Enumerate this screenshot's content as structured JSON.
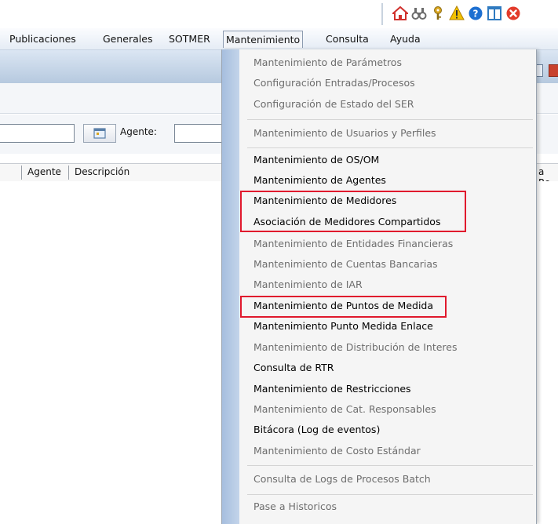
{
  "toolbar": {
    "icons": [
      {
        "name": "home-icon",
        "color": "#d0312d"
      },
      {
        "name": "binoculars-icon",
        "color": "#6b6b6b"
      },
      {
        "name": "key-icon",
        "color": "#d9a520"
      },
      {
        "name": "warning-icon",
        "color": "#f2c200"
      },
      {
        "name": "help-icon",
        "color": "#1c6fd1"
      },
      {
        "name": "columns-icon",
        "color": "#2f7ac0"
      },
      {
        "name": "close-icon",
        "color": "#e23a2a"
      }
    ]
  },
  "menubar": {
    "items": [
      {
        "label": "Publicaciones"
      },
      {
        "label": "Generales"
      },
      {
        "label": "SOTMER"
      },
      {
        "label": "Mantenimiento"
      },
      {
        "label": "Consulta"
      },
      {
        "label": "Ayuda"
      }
    ]
  },
  "filters": {
    "agente_label": "Agente:"
  },
  "grid": {
    "columns": [
      "Agente",
      "Descripción",
      "a Re"
    ]
  },
  "dropdown": {
    "items": [
      {
        "label": "Mantenimiento de Parámetros",
        "enabled": false
      },
      {
        "label": "Configuración Entradas/Procesos",
        "enabled": false
      },
      {
        "label": "Configuración de Estado del SER",
        "enabled": false
      },
      {
        "label": "Mantenimiento de Usuarios y Perfiles",
        "enabled": false
      },
      {
        "label": "Mantenimiento de OS/OM",
        "enabled": true
      },
      {
        "label": "Mantenimiento de Agentes",
        "enabled": true
      },
      {
        "label": "Mantenimiento de Medidores",
        "enabled": true
      },
      {
        "label": "Asociación de Medidores Compartidos",
        "enabled": true
      },
      {
        "label": "Mantenimiento de Entidades Financieras",
        "enabled": false
      },
      {
        "label": "Mantenimiento de Cuentas Bancarias",
        "enabled": false
      },
      {
        "label": "Mantenimiento de IAR",
        "enabled": false
      },
      {
        "label": "Mantenimiento de Puntos de Medida",
        "enabled": true
      },
      {
        "label": "Mantenimiento Punto Medida Enlace",
        "enabled": true
      },
      {
        "label": "Mantenimiento de Distribución de Interes",
        "enabled": false
      },
      {
        "label": "Consulta de RTR",
        "enabled": true
      },
      {
        "label": "Mantenimiento de Restricciones",
        "enabled": true
      },
      {
        "label": "Mantenimiento de Cat. Responsables",
        "enabled": false
      },
      {
        "label": "Bitácora (Log de eventos)",
        "enabled": true
      },
      {
        "label": "Mantenimiento de Costo Estándar",
        "enabled": false
      },
      {
        "label": "Consulta de Logs de Procesos Batch",
        "enabled": false
      },
      {
        "label": "Pase a Historicos",
        "enabled": false
      }
    ]
  },
  "colors": {
    "highlight": "#e0192d",
    "disabled_text": "#6d6d6d"
  }
}
